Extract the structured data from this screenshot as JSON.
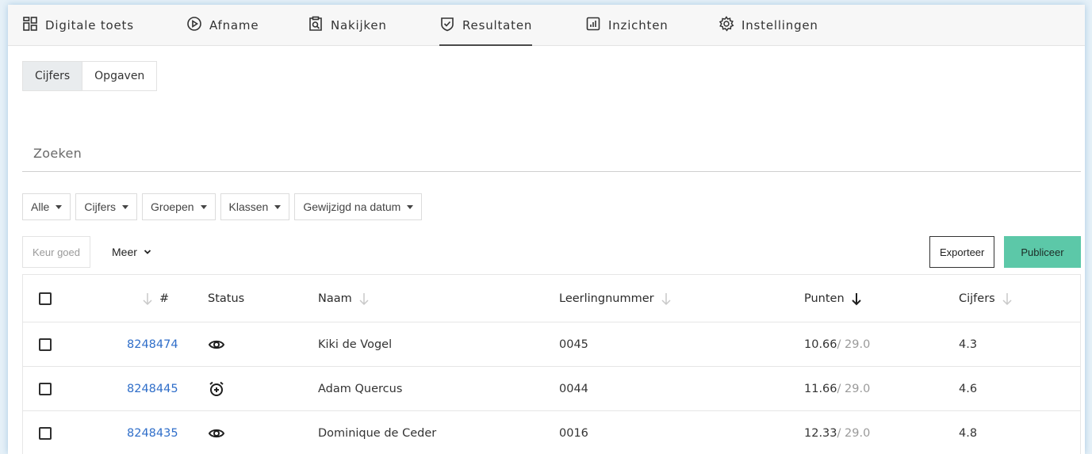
{
  "nav": {
    "items": [
      {
        "label": "Digitale toets",
        "icon": "grid-icon"
      },
      {
        "label": "Afname",
        "icon": "play-circle-icon"
      },
      {
        "label": "Nakijken",
        "icon": "clipboard-search-icon"
      },
      {
        "label": "Resultaten",
        "icon": "shield-check-icon"
      },
      {
        "label": "Inzichten",
        "icon": "bar-chart-icon"
      },
      {
        "label": "Instellingen",
        "icon": "gear-icon"
      }
    ],
    "active": "Resultaten"
  },
  "subtabs": [
    {
      "label": "Cijfers",
      "active": true
    },
    {
      "label": "Opgaven",
      "active": false
    }
  ],
  "search": {
    "placeholder": "Zoeken",
    "value": ""
  },
  "filters": [
    {
      "label": "Alle"
    },
    {
      "label": "Cijfers"
    },
    {
      "label": "Groepen"
    },
    {
      "label": "Klassen"
    },
    {
      "label": "Gewijzigd na datum"
    }
  ],
  "actions": {
    "keur_goed": "Keur goed",
    "meer": "Meer",
    "exporteer": "Exporteer",
    "publiceer": "Publiceer"
  },
  "table": {
    "headers": {
      "number": "#",
      "status": "Status",
      "name": "Naam",
      "student_number": "Leerlingnummer",
      "points": "Punten",
      "grades": "Cijfers"
    },
    "rows": [
      {
        "id": "8248474",
        "status": "eye-icon",
        "name": "Kiki de Vogel",
        "student_number": "0045",
        "points": "10.66",
        "points_total": " / 29.0",
        "grade": "4.3"
      },
      {
        "id": "8248445",
        "status": "alarm-plus-icon",
        "name": "Adam Quercus",
        "student_number": "0044",
        "points": "11.66",
        "points_total": " / 29.0",
        "grade": "4.6"
      },
      {
        "id": "8248435",
        "status": "eye-icon",
        "name": "Dominique de Ceder",
        "student_number": "0016",
        "points": "12.33",
        "points_total": " / 29.0",
        "grade": "4.8"
      }
    ]
  },
  "colors": {
    "accent_publish": "#5cc8a8",
    "link": "#2f6ec9",
    "background": "#e6f1f8"
  }
}
